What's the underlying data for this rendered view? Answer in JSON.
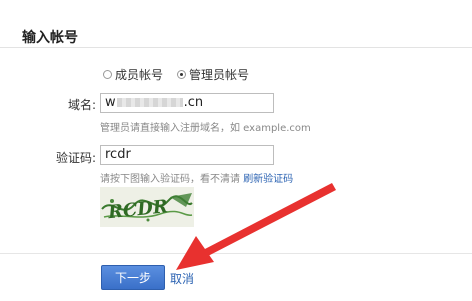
{
  "section": {
    "title": "输入帐号"
  },
  "account_type": {
    "options": [
      {
        "label": "成员帐号",
        "checked": false
      },
      {
        "label": "管理员帐号",
        "checked": true
      }
    ]
  },
  "domain": {
    "label": "域名:",
    "value_prefix": "w",
    "value_suffix": ".cn",
    "hint": "管理员请直接输入注册域名，如 example.com"
  },
  "captcha": {
    "label": "验证码:",
    "value": "rcdr",
    "hint_text": "请按下图输入验证码，看不清请",
    "refresh_link": "刷新验证码",
    "image_text": "RCDR"
  },
  "actions": {
    "next_label": "下一步",
    "cancel_label": "取消"
  },
  "colors": {
    "accent": "#3a70c9",
    "link": "#2d64b3",
    "arrow": "#e8312f"
  }
}
